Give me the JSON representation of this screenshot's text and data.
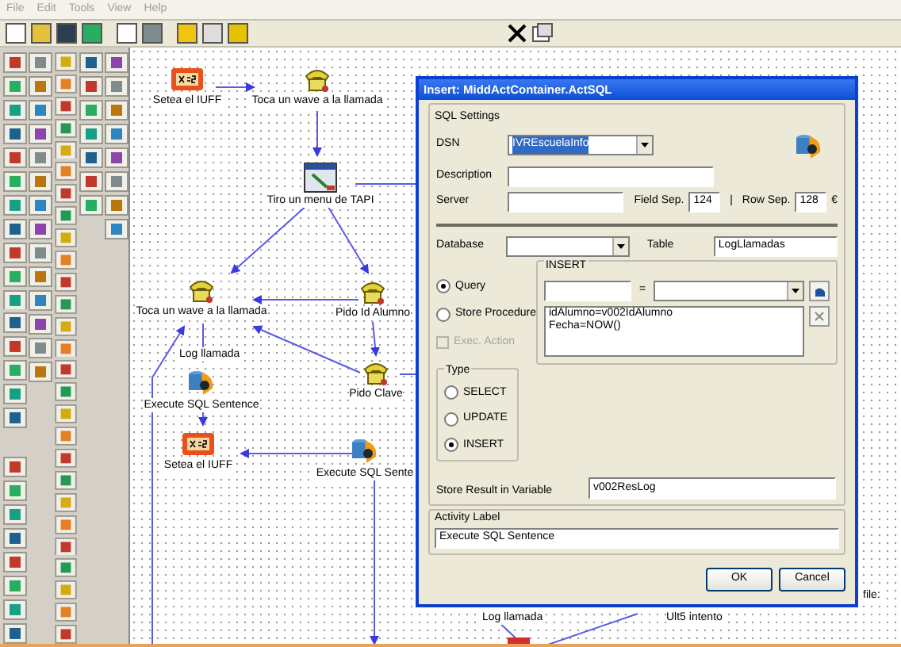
{
  "menu": [
    "File",
    "Edit",
    "Tools",
    "View",
    "Help"
  ],
  "nodes": [
    {
      "label": "Setea el IUFF",
      "kind": "variable"
    },
    {
      "label": "Toca un wave a la llamada",
      "kind": "phone"
    },
    {
      "label": "Tiro un menu de TAPI",
      "kind": "menu"
    },
    {
      "label": "Toca un wave a la llamada",
      "kind": "phone"
    },
    {
      "label": "Pido Id Alumno",
      "kind": "phone"
    },
    {
      "label": "Execute SQL Sentence",
      "kind": "sql"
    },
    {
      "label": "Pido Clave",
      "kind": "phone"
    },
    {
      "label": "Setea el IUFF",
      "kind": "variable"
    },
    {
      "label": "Execute SQL Sente",
      "kind": "sql"
    }
  ],
  "edge_labels": [
    "Log llamada",
    "Log llamada",
    "Ult5 intento",
    "file:"
  ],
  "dialog": {
    "title": "Insert: MiddActContainer.ActSQL",
    "sql_settings": {
      "legend": "SQL Settings",
      "dsn_label": "DSN",
      "dsn_value": "IVREscuelaInfo",
      "description_label": "Description",
      "server_label": "Server",
      "field_sep_label": "Field Sep.",
      "field_sep_value": "124",
      "field_sep_char": "|",
      "row_sep_label": "Row Sep.",
      "row_sep_value": "128",
      "row_sep_char": "€"
    },
    "database_label": "Database",
    "table_label": "Table",
    "table_value": "LogLlamadas",
    "modes": [
      {
        "label": "Query",
        "selected": true
      },
      {
        "label": "Store Procedure",
        "selected": false
      }
    ],
    "exec_action": {
      "label": "Exec. Action",
      "checked": false,
      "disabled": true
    },
    "insert_group": {
      "legend": "INSERT",
      "equals": "=",
      "lines": [
        "idAlumno=v002IdAlumno",
        "Fecha=NOW()"
      ]
    },
    "type_group": {
      "legend": "Type",
      "options": [
        {
          "label": "SELECT",
          "selected": false
        },
        {
          "label": "UPDATE",
          "selected": false
        },
        {
          "label": "INSERT",
          "selected": true
        }
      ]
    },
    "store_result_label": "Store Result in Variable",
    "store_result_value": "v002ResLog",
    "activity_legend": "Activity Label",
    "activity_value": "Execute SQL Sentence",
    "buttons": [
      "OK",
      "Cancel"
    ]
  }
}
